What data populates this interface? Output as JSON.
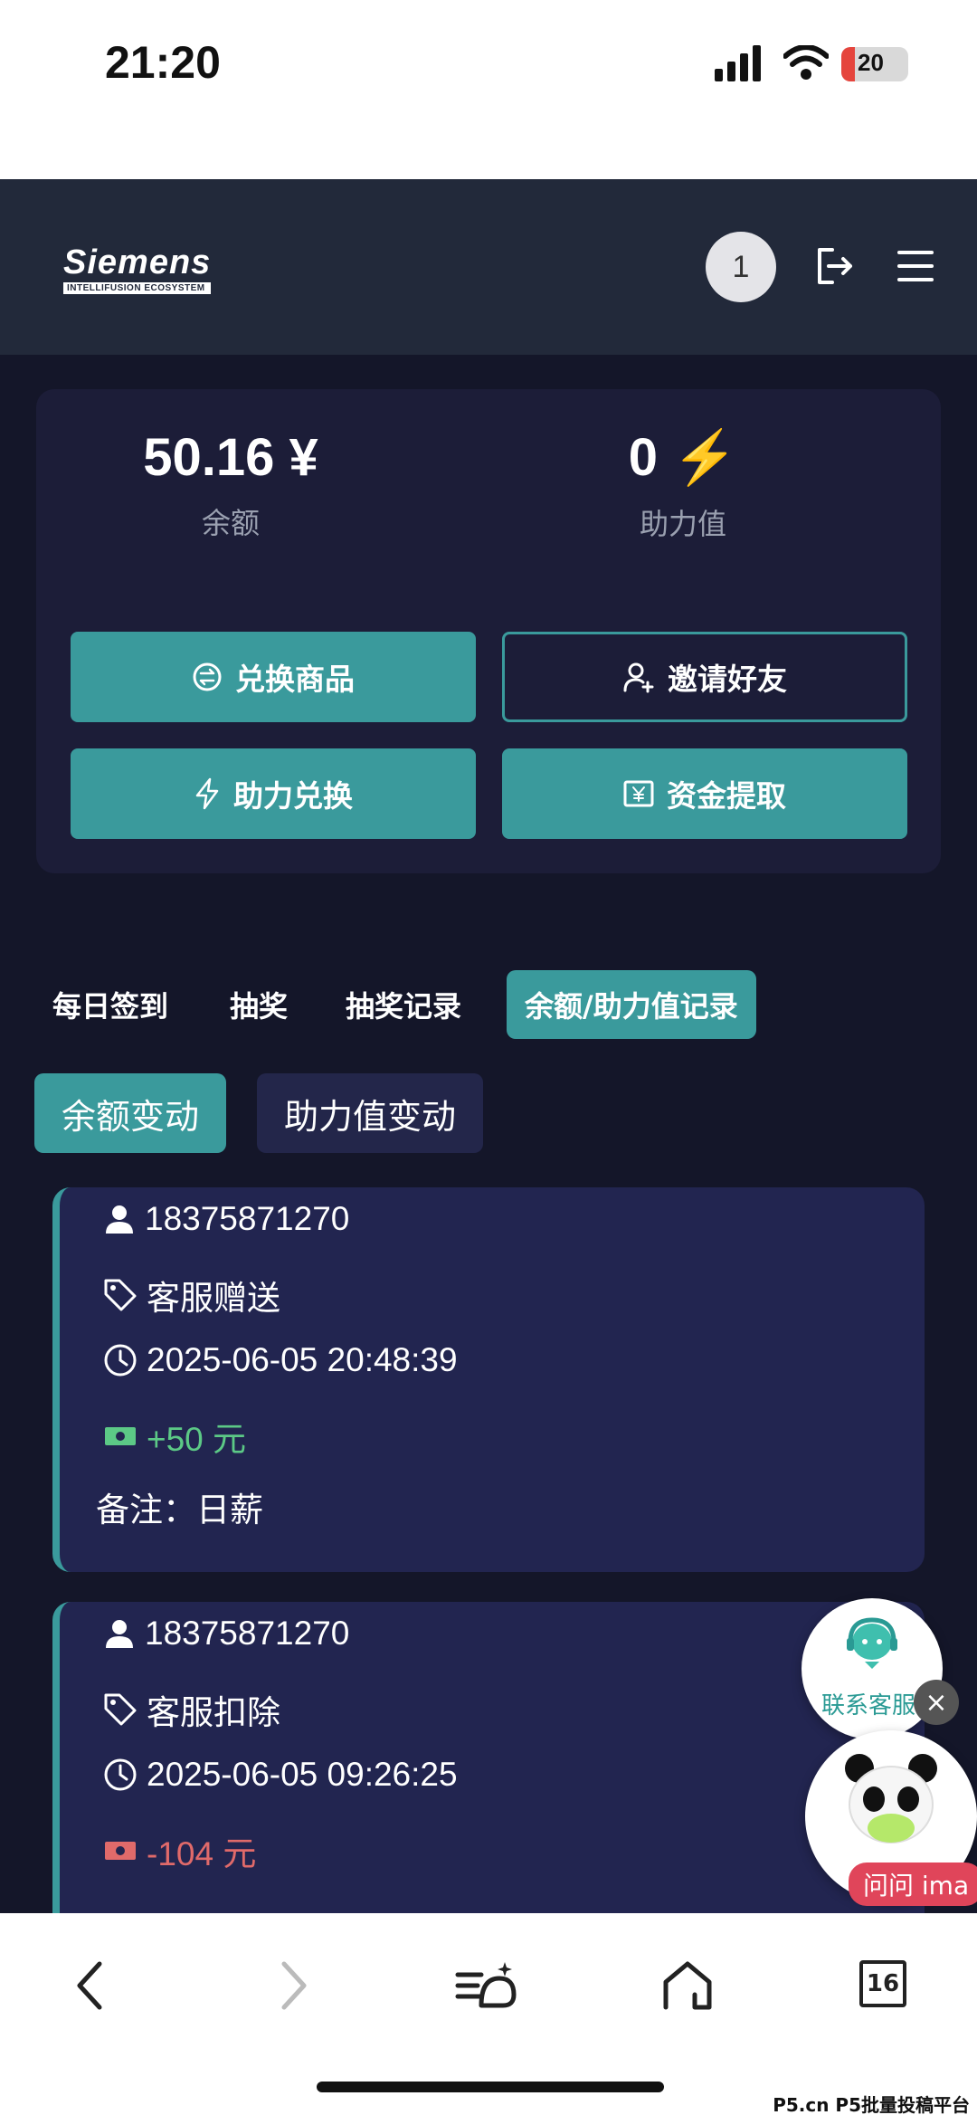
{
  "status_bar": {
    "time": "21:20",
    "battery": "20",
    "battery_fraction": 0.2
  },
  "header": {
    "logo_main": "Siemens",
    "logo_sub": "INTELLIFUSION ECOSYSTEM",
    "notification_count": "1"
  },
  "balance_card": {
    "balance_value": "50.16 ¥",
    "balance_label": "余额",
    "assist_value": "0",
    "assist_label": "助力值",
    "buttons": {
      "exchange_goods": "兑换商品",
      "invite_friends": "邀请好友",
      "assist_exchange": "助力兑换",
      "withdraw": "资金提取"
    }
  },
  "tabs": [
    "每日签到",
    "抽奖",
    "抽奖记录",
    "余额/助力值记录"
  ],
  "subtabs": [
    "余额变动",
    "助力值变动"
  ],
  "records": [
    {
      "user": "18375871270",
      "type": "客服赠送",
      "time": "2025-06-05 20:48:39",
      "amount": "+50 元",
      "note": "备注：日薪"
    },
    {
      "user": "18375871270",
      "type": "客服扣除",
      "time": "2025-06-05 09:26:25",
      "amount": "-104 元"
    }
  ],
  "floating": {
    "service_label": "联系客服",
    "ima_label": "问问 ima"
  },
  "browser_bar": {
    "tab_count": "16"
  },
  "watermark": "P5.cn P5批量投稿平台",
  "colors": {
    "accent": "#3a9a9c",
    "bg": "#141629",
    "card": "#1c1d38",
    "record": "#222550",
    "positive": "#5cc986",
    "negative": "#e06a6a"
  }
}
